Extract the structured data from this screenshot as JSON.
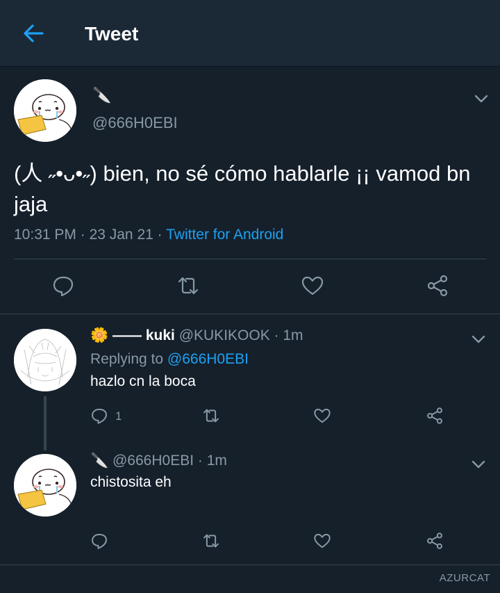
{
  "header": {
    "title": "Tweet"
  },
  "main_tweet": {
    "name_emoji": "🔪",
    "handle": "@666H0EBI",
    "text": "(人 ˶•ᴗ•˶) bien, no sé cómo hablarle ¡¡ vamod bn jaja",
    "time": "10:31 PM",
    "date": "23 Jan 21",
    "separator": " · ",
    "source": "Twitter for Android"
  },
  "replies": [
    {
      "name_emoji": "🌼",
      "name": " —— kuki",
      "handle": " @KUKIKOOK",
      "time": " · 1m",
      "replying_prefix": "Replying to ",
      "replying_to": "@666H0EBI",
      "text": "hazlo cn la boca",
      "reply_count": "1"
    },
    {
      "name_emoji": "🔪",
      "handle": " @666H0EBI",
      "time": " · 1m",
      "text": "chistosita eh"
    }
  ],
  "watermark": "AZURCAT",
  "colors": {
    "background": "#15202b",
    "header_bg": "#1b2836",
    "accent": "#1da1f2",
    "muted": "#8899a6",
    "divider": "#38444d"
  },
  "icons": {
    "back": "arrow-left-icon",
    "more": "chevron-down-icon",
    "reply": "reply-icon",
    "retweet": "retweet-icon",
    "like": "heart-icon",
    "share": "share-icon"
  }
}
